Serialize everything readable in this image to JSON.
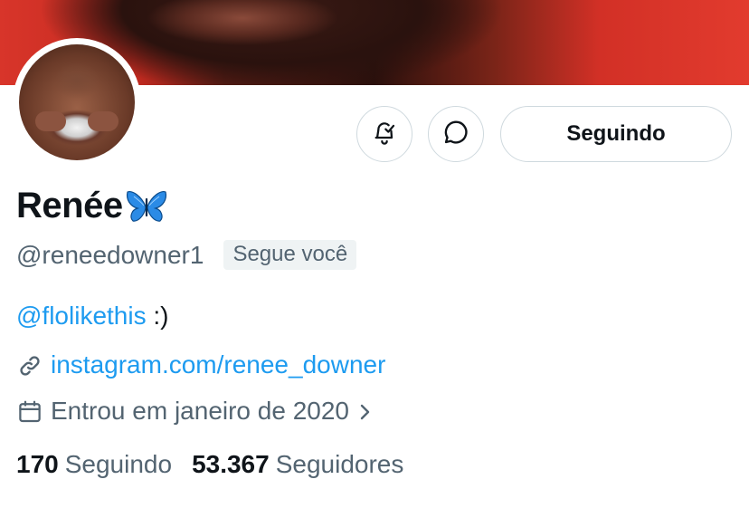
{
  "profile": {
    "name": "Renée",
    "name_emoji": "🦋",
    "handle": "@reneedowner1",
    "follows_you_badge": "Segue você",
    "bio_mention": "@flolikethis",
    "bio_suffix": " :)",
    "website": "instagram.com/renee_downer",
    "joined": "Entrou em janeiro de 2020"
  },
  "actions": {
    "notify_icon": "bell-check-icon",
    "message_icon": "message-bubble-icon",
    "following_label": "Seguindo"
  },
  "stats": {
    "following_count": "170",
    "following_label": "Seguindo",
    "followers_count": "53.367",
    "followers_label": "Seguidores"
  },
  "colors": {
    "accent_link": "#1d9bf0",
    "secondary_text": "#536471",
    "primary_text": "#0f1419",
    "border": "#cfd9de",
    "butterfly": "#2b8be6"
  }
}
